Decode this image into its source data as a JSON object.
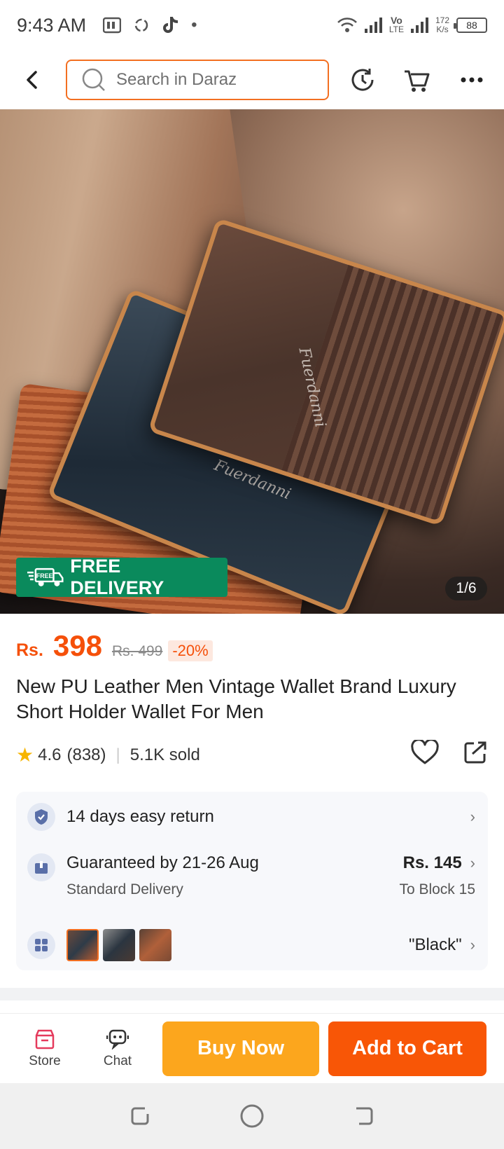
{
  "status_bar": {
    "time": "9:43 AM",
    "network_label_top": "Vo",
    "network_label_bottom": "LTE",
    "speed_value": "172",
    "speed_unit": "K/s",
    "battery": "88"
  },
  "header": {
    "search_placeholder": "Search in Daraz"
  },
  "hero": {
    "brand_script": "Fuerdanni",
    "free_tag": "FREE",
    "free_delivery_label": "FREE DELIVERY",
    "image_counter": "1/6"
  },
  "product": {
    "currency": "Rs.",
    "price": "398",
    "original_price": "Rs. 499",
    "discount": "-20%",
    "title": "New PU Leather Men Vintage Wallet Brand Luxury Short Holder Wallet For Men",
    "rating": "4.6",
    "rating_count": "(838)",
    "sold": "5.1K sold"
  },
  "info": {
    "return_text": "14 days easy return",
    "delivery_text": "Guaranteed by 21-26 Aug",
    "delivery_sub": "Standard Delivery",
    "delivery_price": "Rs. 145",
    "delivery_location": "To Block 15",
    "variant_selected": "\"Black\""
  },
  "bottom_bar": {
    "store_label": "Store",
    "chat_label": "Chat",
    "buy_now_label": "Buy Now",
    "add_to_cart_label": "Add to Cart"
  },
  "colors": {
    "accent": "#f85606",
    "buy_now": "#fca61d",
    "free_delivery": "#0a8a5c"
  }
}
